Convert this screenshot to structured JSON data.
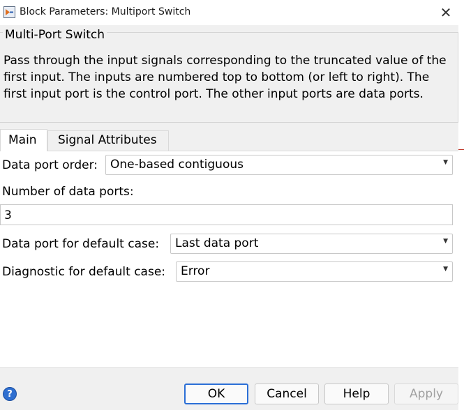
{
  "window": {
    "title": "Block Parameters: Multiport Switch",
    "icon": "simulink-block-icon"
  },
  "description": {
    "group_title": "Multi-Port Switch",
    "text": "Pass through the input signals corresponding to the truncated value of the first input. The inputs are numbered top to bottom (or left to right). The first input port is the control port. The other input ports are data ports."
  },
  "tabs": [
    {
      "label": "Main",
      "active": true
    },
    {
      "label": "Signal Attributes",
      "active": false
    }
  ],
  "params": {
    "data_port_order": {
      "label": "Data port order:",
      "value": "One-based contiguous"
    },
    "num_data_ports": {
      "label": "Number of data ports:",
      "value": "3"
    },
    "default_case_port": {
      "label": "Data port for default case:",
      "value": "Last data port"
    },
    "diagnostic_default": {
      "label": "Diagnostic for default case:",
      "value": "Error"
    }
  },
  "buttons": {
    "ok": "OK",
    "cancel": "Cancel",
    "help": "Help",
    "apply": "Apply"
  },
  "colors": {
    "accent": "#2b6fd6",
    "background": "#f0f0f0"
  }
}
